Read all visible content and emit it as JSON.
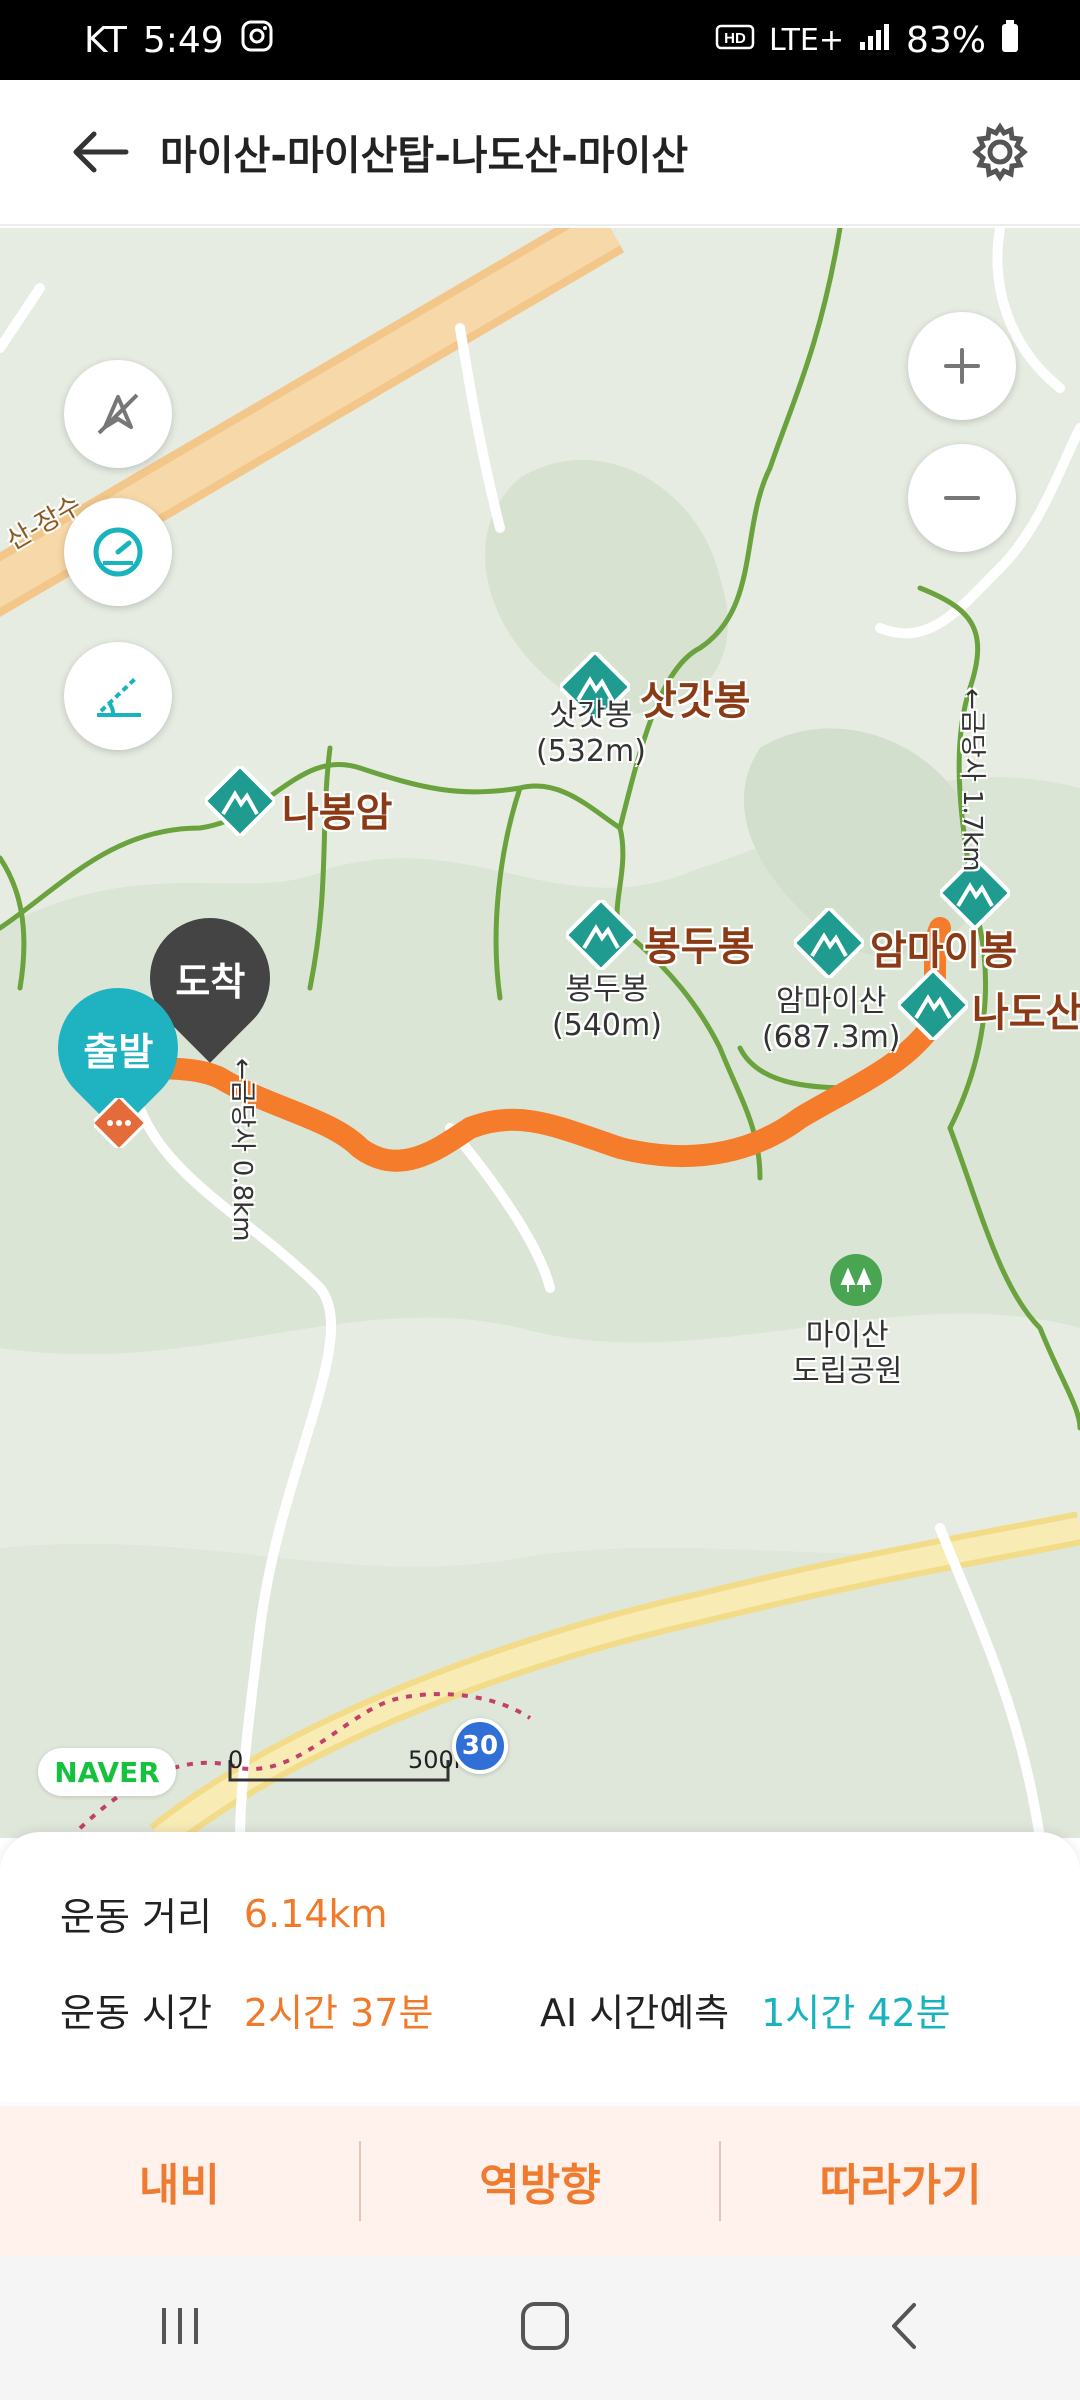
{
  "status": {
    "carrier": "KT",
    "time": "5:49",
    "network": "LTE+",
    "battery": "83%"
  },
  "header": {
    "title": "마이산-마이산탑-나도산-마이산"
  },
  "map": {
    "markers": {
      "start": "출발",
      "end": "도착"
    },
    "peaks": [
      {
        "name": "삿갓봉"
      },
      {
        "name": "나봉암"
      },
      {
        "name": "봉두봉"
      },
      {
        "name": "암마이봉"
      },
      {
        "name": "나도산"
      }
    ],
    "small_labels": {
      "sat_elev": "삿갓봉\n(532m)",
      "bong_elev": "봉두봉\n(540m)",
      "am_elev": "암마이산\n(687.3m)",
      "park": "마이산\n도립공원"
    },
    "trail_labels": {
      "north": "←금당사 0.8km",
      "east": "←금당사 1.7km"
    },
    "road_label": "산-장수",
    "route_number": "30",
    "scale": {
      "left": "0",
      "right": "500m"
    },
    "brand": "NAVER"
  },
  "stats": {
    "distance_label": "운동 거리",
    "distance_value": "6.14km",
    "time_label": "운동 시간",
    "time_value": "2시간 37분",
    "ai_label": "AI 시간예측",
    "ai_value": "1시간 42분"
  },
  "actions": {
    "navi": "내비",
    "reverse": "역방향",
    "follow": "따라가기"
  },
  "colors": {
    "route": "#f57c2a",
    "teal": "#19b3be",
    "orange": "#f07a2a"
  }
}
